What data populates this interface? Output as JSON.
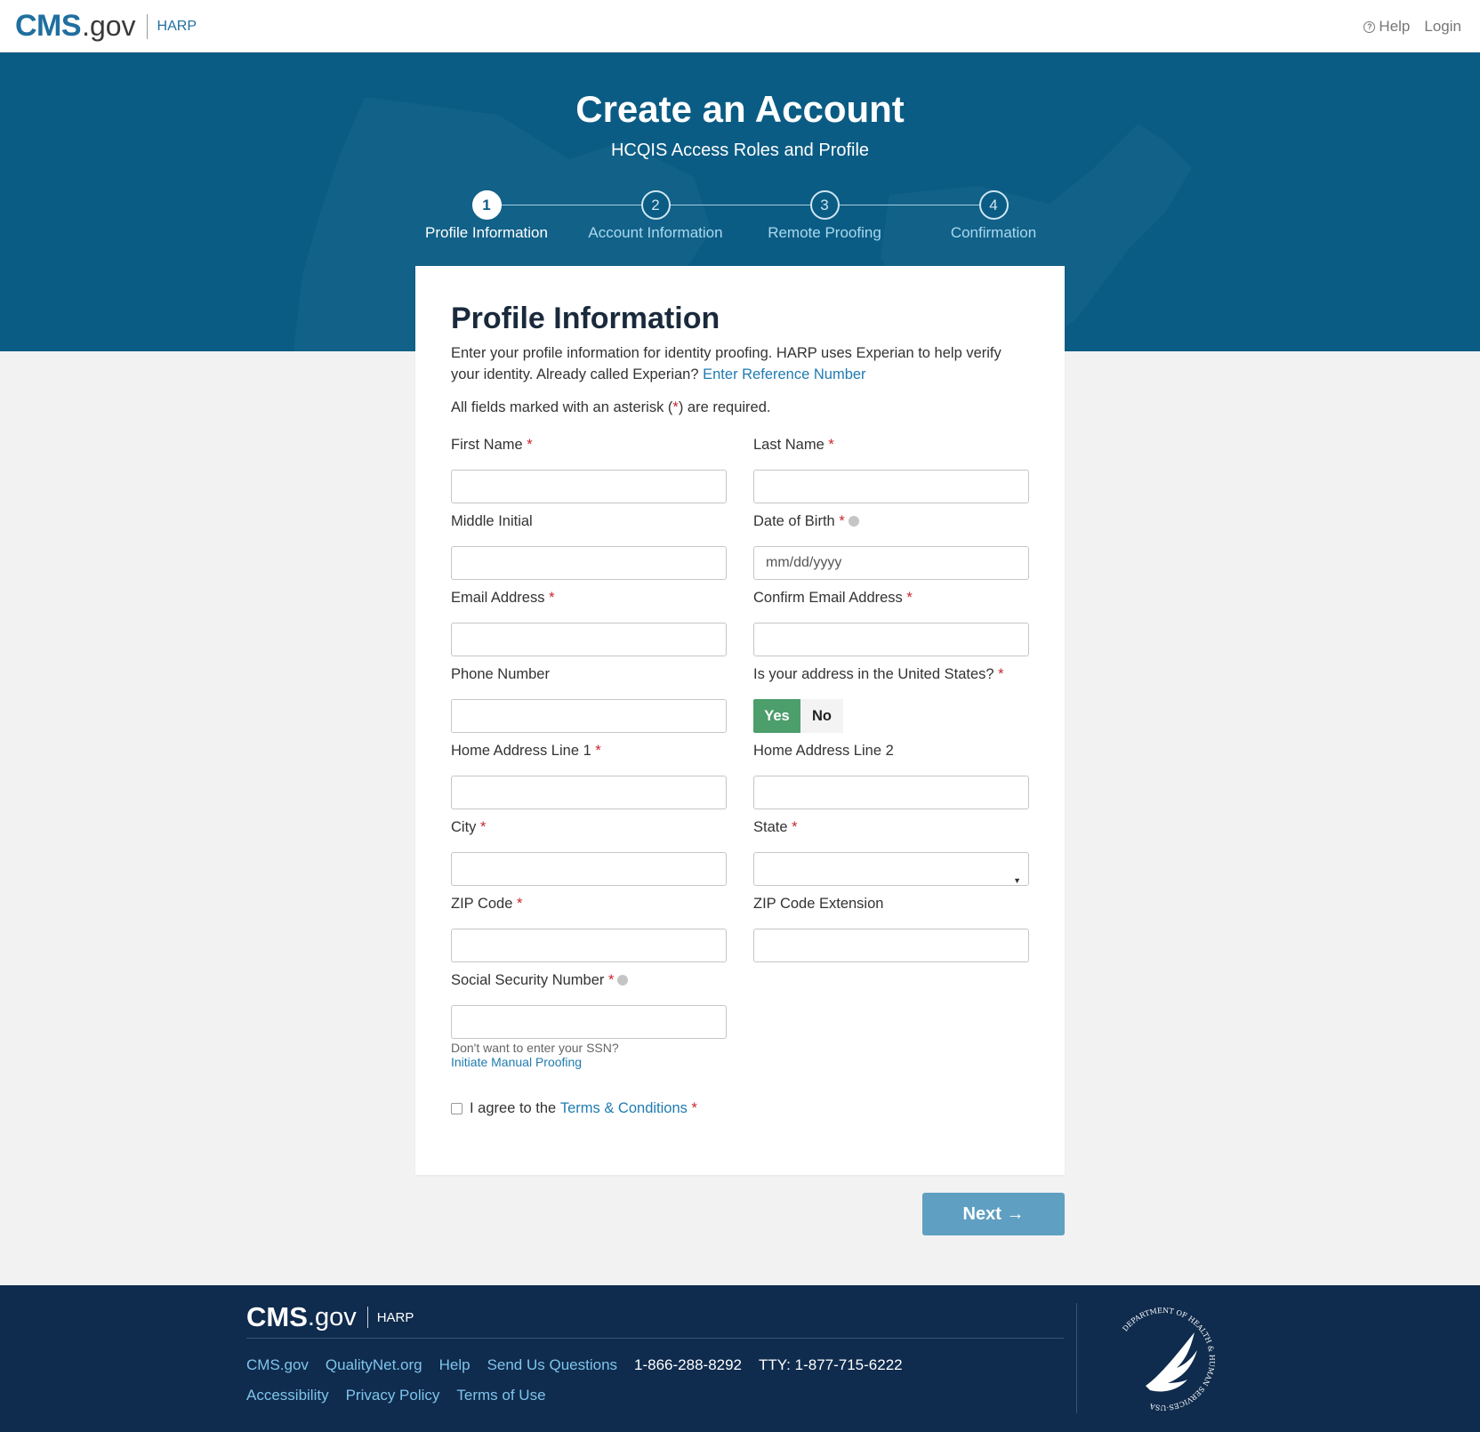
{
  "header": {
    "brand_cms": "CMS",
    "brand_gov": ".gov",
    "brand_app": "HARP",
    "help_label": "Help",
    "help_icon": "question-circle-icon",
    "login_label": "Login"
  },
  "hero": {
    "title": "Create an Account",
    "subtitle": "HCQIS Access Roles and Profile",
    "steps": [
      {
        "number": "1",
        "label": "Profile Information",
        "active": true
      },
      {
        "number": "2",
        "label": "Account Information",
        "active": false
      },
      {
        "number": "3",
        "label": "Remote Proofing",
        "active": false
      },
      {
        "number": "4",
        "label": "Confirmation",
        "active": false
      }
    ]
  },
  "form": {
    "heading": "Profile Information",
    "intro_text": "Enter your profile information for identity proofing. HARP uses Experian to help verify your identity. Already called Experian?",
    "intro_link": "Enter Reference Number",
    "required_prefix": "All fields marked with an asterisk (",
    "required_star": "*",
    "required_suffix": ") are required.",
    "fields": {
      "first_name": {
        "label": "First Name",
        "value": ""
      },
      "last_name": {
        "label": "Last Name",
        "value": ""
      },
      "middle_initial": {
        "label": "Middle Initial",
        "value": ""
      },
      "dob": {
        "label": "Date of Birth",
        "placeholder": "mm/dd/yyyy"
      },
      "email": {
        "label": "Email Address",
        "value": ""
      },
      "confirm_email": {
        "label": "Confirm Email Address",
        "value": ""
      },
      "phone": {
        "label": "Phone Number",
        "value": ""
      },
      "us_address": {
        "label": "Is your address in the United States?",
        "yes": "Yes",
        "no": "No",
        "selected": "Yes"
      },
      "address1": {
        "label": "Home Address Line 1",
        "value": ""
      },
      "address2": {
        "label": "Home Address Line 2",
        "value": ""
      },
      "city": {
        "label": "City",
        "value": ""
      },
      "state": {
        "label": "State",
        "value": ""
      },
      "zip": {
        "label": "ZIP Code",
        "value": ""
      },
      "zip_ext": {
        "label": "ZIP Code Extension",
        "value": ""
      },
      "ssn": {
        "label": "Social Security Number",
        "value": ""
      }
    },
    "star": "*",
    "ssn_help": "Don't want to enter your SSN?",
    "ssn_link": "Initiate Manual Proofing",
    "terms_prefix": "I agree to the",
    "terms_link": "Terms & Conditions",
    "terms_checked": false,
    "next_label": "Next"
  },
  "footer": {
    "brand_cms": "CMS",
    "brand_gov": ".gov",
    "brand_app": "HARP",
    "links_row1": [
      "CMS.gov",
      "QualityNet.org",
      "Help",
      "Send Us Questions"
    ],
    "phone": "1-866-288-8292",
    "tty": "TTY: 1-877-715-6222",
    "links_row2": [
      "Accessibility",
      "Privacy Policy",
      "Terms of Use"
    ],
    "seal_text": "DEPARTMENT OF HEALTH & HUMAN SERVICES·USA"
  },
  "colors": {
    "brand_blue": "#1f6fa0",
    "hero_bg": "#0b5c84",
    "yes_green": "#4c9e6a",
    "next_button": "#5f9fc2",
    "footer_bg": "#0f2b4d",
    "link": "#1f7bb0",
    "required_red": "#c7262d"
  }
}
